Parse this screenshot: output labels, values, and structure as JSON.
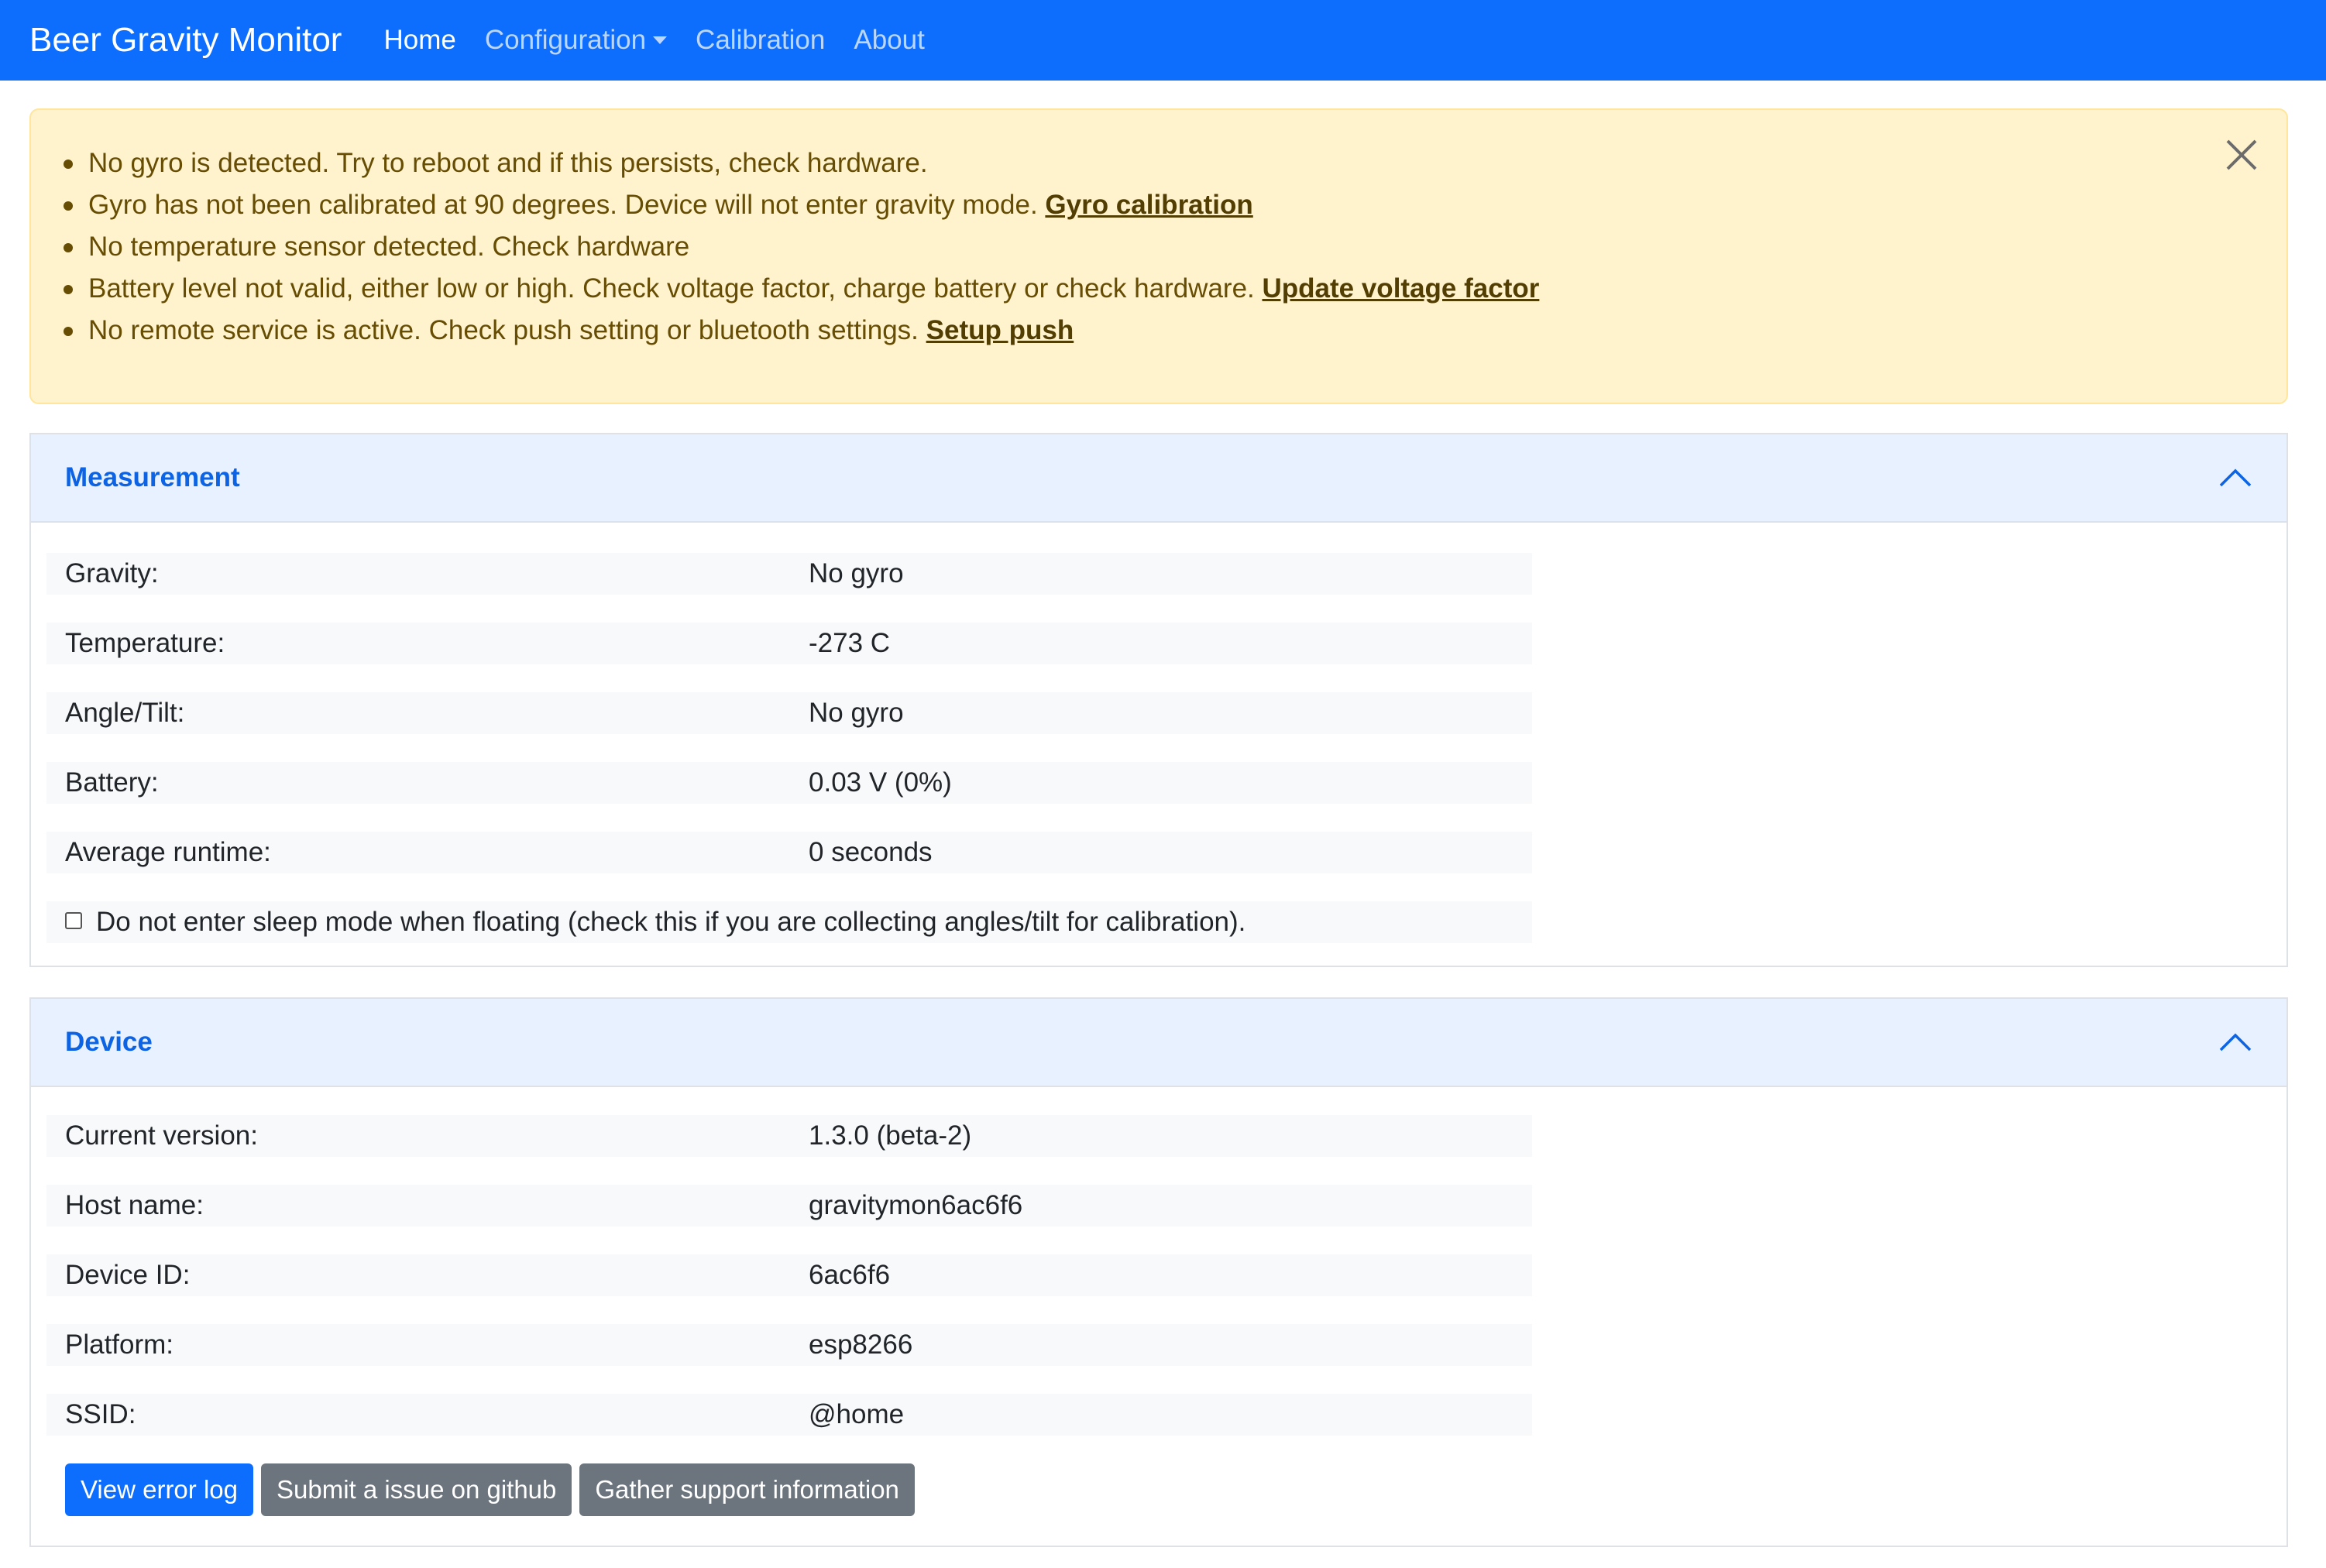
{
  "navbar": {
    "brand": "Beer Gravity Monitor",
    "links": {
      "home": "Home",
      "configuration": "Configuration",
      "calibration": "Calibration",
      "about": "About"
    }
  },
  "alert": {
    "item1": {
      "text": "No gyro is detected. Try to reboot and if this persists, check hardware."
    },
    "item2": {
      "text": "Gyro has not been calibrated at 90 degrees. Device will not enter gravity mode. ",
      "link": "Gyro calibration"
    },
    "item3": {
      "text": "No temperature sensor detected. Check hardware"
    },
    "item4": {
      "text": "Battery level not valid, either low or high. Check voltage factor, charge battery or check hardware. ",
      "link": "Update voltage factor"
    },
    "item5": {
      "text": "No remote service is active. Check push setting or bluetooth settings. ",
      "link": "Setup push"
    },
    "close_icon": "close-icon"
  },
  "measurement": {
    "title": "Measurement",
    "gravity": {
      "label": "Gravity:",
      "value": "No gyro"
    },
    "temperature": {
      "label": "Temperature:",
      "value": "-273 C"
    },
    "angle": {
      "label": "Angle/Tilt:",
      "value": "No gyro"
    },
    "battery": {
      "label": "Battery:",
      "value": "0.03 V (0%)"
    },
    "runtime": {
      "label": "Average runtime:",
      "value": "0 seconds"
    },
    "sleep_checkbox": {
      "label": "Do not enter sleep mode when floating (check this if you are collecting angles/tilt for calibration).",
      "checked": false
    }
  },
  "device": {
    "title": "Device",
    "version": {
      "label": "Current version:",
      "value": "1.3.0 (beta-2)"
    },
    "hostname": {
      "label": "Host name:",
      "value": "gravitymon6ac6f6"
    },
    "device_id": {
      "label": "Device ID:",
      "value": "6ac6f6"
    },
    "platform": {
      "label": "Platform:",
      "value": "esp8266"
    },
    "ssid": {
      "label": "SSID:",
      "value": "@home"
    },
    "buttons": {
      "error_log": "View error log",
      "github": "Submit a issue on github",
      "support": "Gather support information"
    }
  },
  "colors": {
    "primary": "#0d6efd",
    "secondary": "#6c757d",
    "warning_bg": "#fff3cd",
    "warning_text": "#664d03",
    "accordion_active": "#e7f1ff",
    "accordion_title": "#0c63e4"
  }
}
